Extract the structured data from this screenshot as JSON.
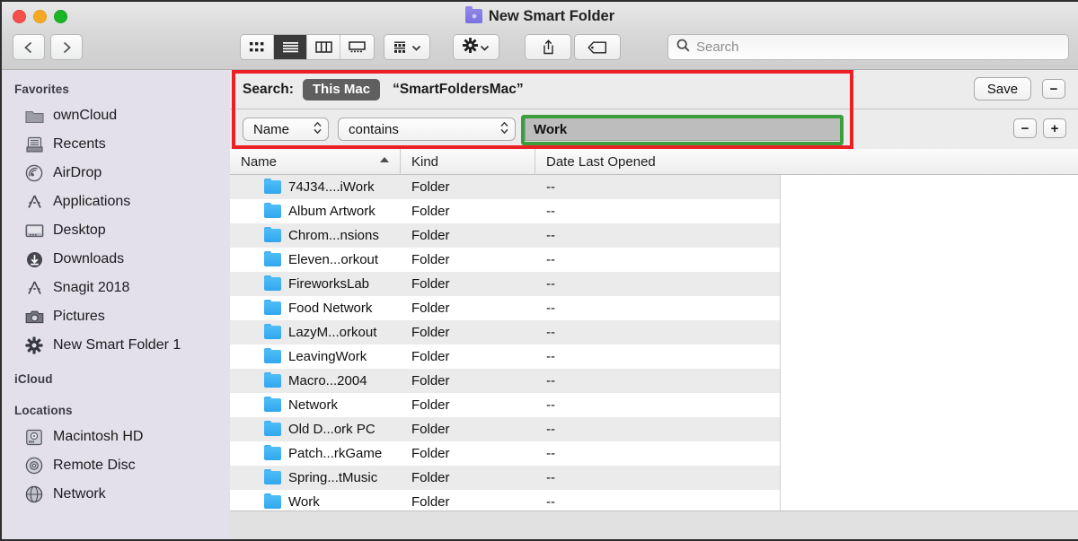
{
  "window": {
    "title": "New Smart Folder",
    "title_icon": "smart-folder-icon",
    "traffic_lights": [
      "close-button",
      "minimize-button",
      "zoom-button"
    ]
  },
  "toolbar": {
    "back_label": "‹",
    "forward_label": "›",
    "views": [
      {
        "name": "icon-view",
        "active": false
      },
      {
        "name": "list-view",
        "active": true
      },
      {
        "name": "column-view",
        "active": false
      },
      {
        "name": "gallery-view",
        "active": false
      }
    ],
    "arrange_label": "arrange-by-icon",
    "action_label": "gear-icon",
    "share_label": "share-icon",
    "tags_label": "tag-icon",
    "chevron": "⌄"
  },
  "search": {
    "placeholder": "Search",
    "icon": "search-icon"
  },
  "sidebar": {
    "sections": [
      {
        "header": "Favorites",
        "items": [
          {
            "label": "ownCloud",
            "icon": "folder-icon"
          },
          {
            "label": "Recents",
            "icon": "recents-icon"
          },
          {
            "label": "AirDrop",
            "icon": "airdrop-icon"
          },
          {
            "label": "Applications",
            "icon": "applications-icon"
          },
          {
            "label": "Desktop",
            "icon": "desktop-icon"
          },
          {
            "label": "Downloads",
            "icon": "downloads-icon"
          },
          {
            "label": "Snagit 2018",
            "icon": "applications-icon"
          },
          {
            "label": "Pictures",
            "icon": "camera-icon"
          },
          {
            "label": "New Smart Folder 1",
            "icon": "gear-icon"
          }
        ]
      },
      {
        "header": "iCloud",
        "items": []
      },
      {
        "header": "Locations",
        "items": [
          {
            "label": "Macintosh HD",
            "icon": "harddisk-icon"
          },
          {
            "label": "Remote Disc",
            "icon": "disc-icon"
          },
          {
            "label": "Network",
            "icon": "network-icon"
          }
        ]
      }
    ]
  },
  "criteria": {
    "search_label": "Search:",
    "scope_pill": "This Mac",
    "scope_location": "“SmartFoldersMac”",
    "save_label": "Save",
    "remove_scope_label": "−",
    "attribute": "Name",
    "operator": "contains",
    "value": "Work",
    "remove_rule_label": "−",
    "add_rule_label": "+",
    "highlight_red": "#ec2024",
    "highlight_green": "#3c9e3f"
  },
  "list": {
    "columns": [
      "Name",
      "Kind",
      "Date Last Opened"
    ],
    "sort_column": "Name",
    "sort_direction": "ascending",
    "rows": [
      {
        "name": "74J34....iWork",
        "kind": "Folder",
        "date": "--"
      },
      {
        "name": "Album Artwork",
        "kind": "Folder",
        "date": "--"
      },
      {
        "name": "Chrom...nsions",
        "kind": "Folder",
        "date": "--"
      },
      {
        "name": "Eleven...orkout",
        "kind": "Folder",
        "date": "--"
      },
      {
        "name": "FireworksLab",
        "kind": "Folder",
        "date": "--"
      },
      {
        "name": "Food Network",
        "kind": "Folder",
        "date": "--"
      },
      {
        "name": "LazyM...orkout",
        "kind": "Folder",
        "date": "--"
      },
      {
        "name": "LeavingWork",
        "kind": "Folder",
        "date": "--"
      },
      {
        "name": "Macro...2004",
        "kind": "Folder",
        "date": "--"
      },
      {
        "name": "Network",
        "kind": "Folder",
        "date": "--"
      },
      {
        "name": "Old D...ork PC",
        "kind": "Folder",
        "date": "--"
      },
      {
        "name": "Patch...rkGame",
        "kind": "Folder",
        "date": "--"
      },
      {
        "name": "Spring...tMusic",
        "kind": "Folder",
        "date": "--"
      },
      {
        "name": "Work",
        "kind": "Folder",
        "date": "--"
      }
    ]
  }
}
